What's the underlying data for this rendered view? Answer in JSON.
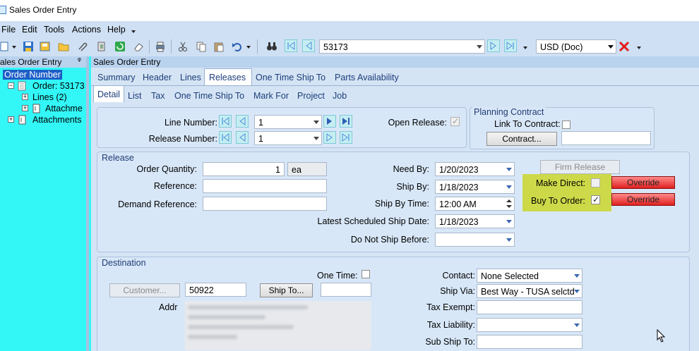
{
  "window": {
    "title": "Sales Order Entry"
  },
  "menu": [
    "File",
    "Edit",
    "Tools",
    "Actions",
    "Help"
  ],
  "toolbar": {
    "order_number": "53173",
    "currency": "USD (Doc)"
  },
  "tree": {
    "header": "ales Order Entry",
    "items": [
      {
        "label": "Order Number",
        "selected": true
      },
      {
        "label": "Order: 53173"
      },
      {
        "label": "Lines (2)"
      },
      {
        "label": "Attachme"
      },
      {
        "label": "Attachments"
      }
    ]
  },
  "main": {
    "header": "Sales Order Entry",
    "tabs": [
      "Summary",
      "Header",
      "Lines",
      "Releases",
      "One Time Ship To",
      "Parts Availability"
    ],
    "active_tab": "Releases",
    "subtabs": [
      "Detail",
      "List",
      "Tax",
      "One Time Ship To",
      "Mark For",
      "Project",
      "Job"
    ],
    "active_subtab": "Detail"
  },
  "numbers": {
    "line_number_label": "Line Number:",
    "line_number": "1",
    "release_number_label": "Release Number:",
    "release_number": "1",
    "open_release_label": "Open Release:",
    "open_release_checked": true
  },
  "planning": {
    "title": "Planning Contract",
    "link_label": "Link To Contract:",
    "contract_button": "Contract..."
  },
  "release": {
    "title": "Release",
    "order_qty_label": "Order Quantity:",
    "order_qty": "1",
    "uom": "ea",
    "reference_label": "Reference:",
    "demand_ref_label": "Demand Reference:",
    "need_by_label": "Need By:",
    "need_by": "1/20/2023",
    "ship_by_label": "Ship By:",
    "ship_by": "1/18/2023",
    "ship_by_time_label": "Ship By Time:",
    "ship_by_time": "12:00 AM",
    "latest_ship_label": "Latest Scheduled Ship Date:",
    "latest_ship": "1/18/2023",
    "do_not_ship_label": "Do Not Ship Before:",
    "firm_release_button": "Firm Release",
    "make_direct_label": "Make Direct:",
    "buy_to_order_label": "Buy To Order:",
    "buy_to_order_checked": true,
    "override_1": "Override",
    "override_2": "Override",
    "highlight_color": "#cdd948"
  },
  "destination": {
    "title": "Destination",
    "one_time_label": "One Time:",
    "customer_button": "Customer...",
    "customer_id": "50922",
    "ship_to_button": "Ship To...",
    "addr_label": "Addr",
    "contact_label": "Contact:",
    "contact": "None Selected",
    "ship_via_label": "Ship Via:",
    "ship_via": "Best Way - TUSA selctd",
    "tax_exempt_label": "Tax Exempt:",
    "tax_liability_label": "Tax Liability:",
    "sub_ship_to_label": "Sub Ship To:"
  },
  "colors": {
    "tree_bg": "#33f7f7",
    "panel_bg": "#d5e4f4",
    "override_red": "#e02020"
  }
}
